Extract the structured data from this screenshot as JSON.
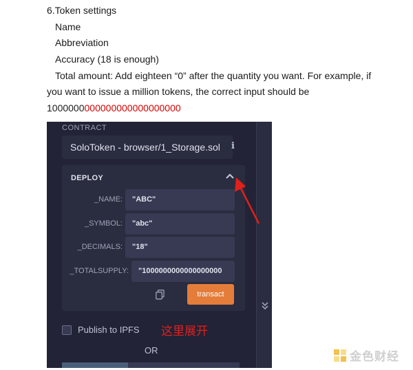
{
  "document": {
    "heading": "6.Token settings",
    "items": [
      "Name",
      "Abbreviation",
      "Accuracy (18 is enough)"
    ],
    "total_amount_text": "Total amount: Add eighteen “0” after the quantity you want. For example, if",
    "total_amount_text_2": "you want to issue a million tokens, the correct input should be",
    "example_prefix": "1000000",
    "example_zeros": "000000000000000000"
  },
  "remix": {
    "contract_label": "CONTRACT",
    "contract_selected": "SoloToken - browser/1_Storage.sol",
    "deploy_title": "DEPLOY",
    "params": [
      {
        "label": "_NAME:",
        "value": "\"ABC\""
      },
      {
        "label": "_SYMBOL:",
        "value": "\"abc\""
      },
      {
        "label": "_DECIMALS:",
        "value": "\"18\""
      },
      {
        "label": "_TOTALSUPPLY:",
        "value": "\"1000000000000000000"
      }
    ],
    "transact_label": "transact",
    "publish_label": "Publish to IPFS",
    "or_label": "OR",
    "annotation": "这里展开"
  },
  "watermark": {
    "text": "金色财经"
  },
  "colors": {
    "accent": "#e47c3a",
    "panel": "#222336",
    "annotation": "#e0201c",
    "highlight_zeros": "#d40000"
  },
  "icons": [
    "info-icon",
    "caret-up-icon",
    "copy-icon",
    "chevron-double-down-icon",
    "checkbox",
    "red-arrow",
    "jinse-logo"
  ]
}
